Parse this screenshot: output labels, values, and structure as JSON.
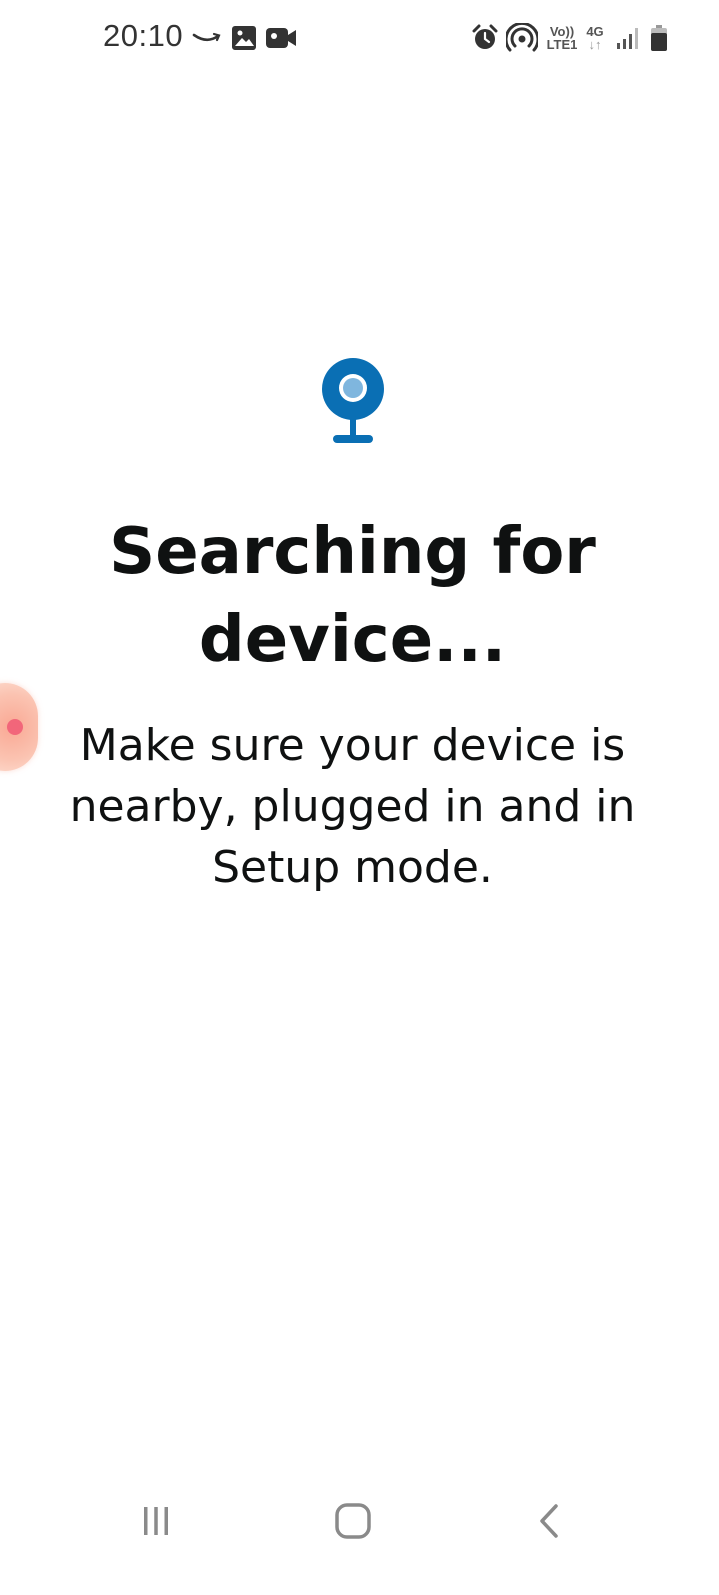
{
  "status_bar": {
    "time": "20:10",
    "notification_icons": [
      "amazon-smile-icon",
      "image-icon",
      "video-camera-icon"
    ],
    "system_icons": [
      "alarm-icon",
      "hotspot-icon",
      "volte-icon",
      "4g-data-icon",
      "signal-icon",
      "battery-icon"
    ],
    "volte_top": "Vo))",
    "volte_bottom": "LTE1",
    "network_type": "4G",
    "network_arrows": "↓↑"
  },
  "main": {
    "device_icon": "camera-device-icon",
    "title_line1": "Searching for",
    "title_line2": "device...",
    "subtitle_line1": "Make sure your device is",
    "subtitle_line2": "nearby, plugged in and in",
    "subtitle_line3": "Setup mode."
  },
  "colors": {
    "accent": "#0a6fb4",
    "accent_light": "#7fb6de",
    "text": "#0f1111",
    "status_text": "#333333",
    "nav_icon": "#8a8a8a"
  },
  "nav_bar": {
    "buttons": [
      "recent-apps-button",
      "home-button",
      "back-button"
    ]
  }
}
